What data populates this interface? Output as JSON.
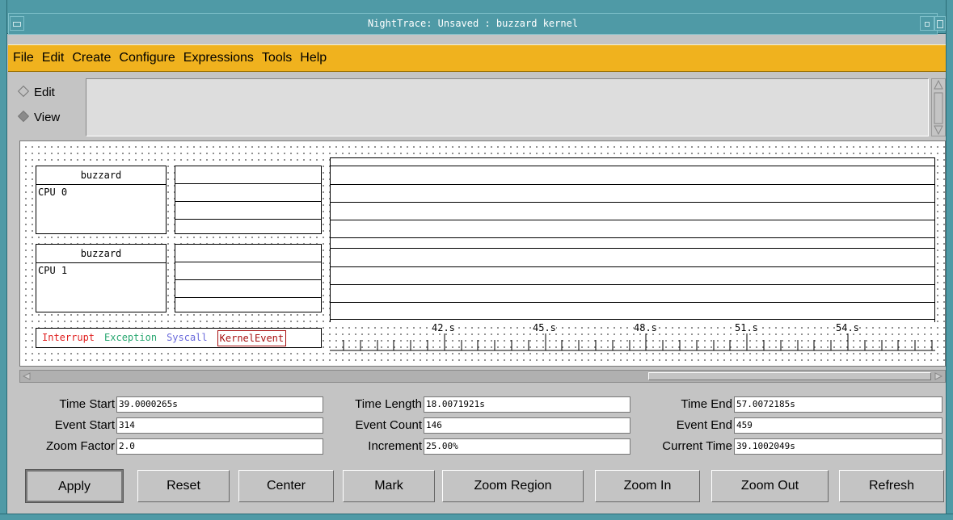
{
  "window": {
    "title": "NightTrace: Unsaved : buzzard kernel"
  },
  "menubar": {
    "items": [
      "File",
      "Edit",
      "Create",
      "Configure",
      "Expressions",
      "Tools",
      "Help"
    ]
  },
  "mode": {
    "options": [
      {
        "label": "Edit",
        "selected": false
      },
      {
        "label": "View",
        "selected": true
      }
    ]
  },
  "profiles": [
    {
      "header": "buzzard",
      "cpu": "CPU 0"
    },
    {
      "header": "buzzard",
      "cpu": "CPU 1"
    }
  ],
  "legend": [
    {
      "label": "Interrupt",
      "color": "#e02020"
    },
    {
      "label": "Exception",
      "color": "#2aa872"
    },
    {
      "label": "Syscall",
      "color": "#6b6bdc"
    },
    {
      "label": "KernelEvent",
      "color": "#a81010"
    }
  ],
  "ruler": {
    "tick_labels": [
      "42.s",
      "45.s",
      "48.s",
      "51.s",
      "54.s"
    ]
  },
  "fields": {
    "time_start": {
      "label": "Time Start",
      "value": "39.0000265s"
    },
    "time_length": {
      "label": "Time Length",
      "value": "18.0071921s"
    },
    "time_end": {
      "label": "Time End",
      "value": "57.0072185s"
    },
    "event_start": {
      "label": "Event Start",
      "value": "314"
    },
    "event_count": {
      "label": "Event Count",
      "value": "146"
    },
    "event_end": {
      "label": "Event End",
      "value": "459"
    },
    "zoom_factor": {
      "label": "Zoom Factor",
      "value": "2.0"
    },
    "increment": {
      "label": "Increment",
      "value": "25.00%"
    },
    "current_time": {
      "label": "Current Time",
      "value": "39.1002049s"
    }
  },
  "buttons": [
    "Apply",
    "Reset",
    "Center",
    "Mark",
    "Zoom Region",
    "Zoom In",
    "Zoom Out",
    "Refresh"
  ]
}
